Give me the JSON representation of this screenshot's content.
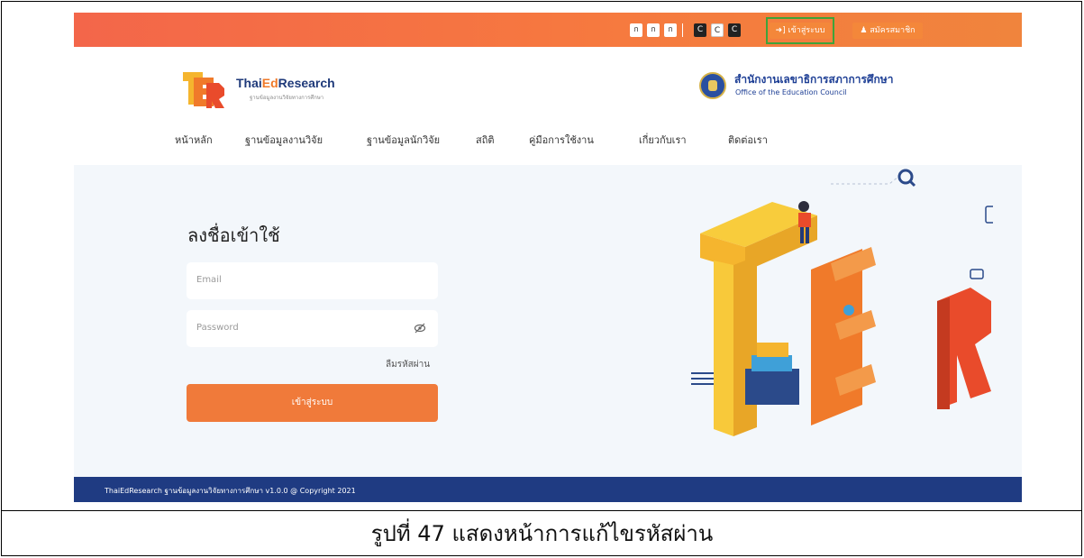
{
  "topbar": {
    "font_size_buttons": [
      "ก",
      "ก",
      "ก"
    ],
    "contrast_buttons": [
      "C",
      "C",
      "C"
    ],
    "login_label": "เข้าสู่ระบบ",
    "register_label": "สมัครสมาชิก"
  },
  "brand": {
    "name_prefix": "Thai",
    "name_highlight": "Ed",
    "name_suffix": "Research",
    "tagline": "ฐานข้อมูลงานวิจัยทางการศึกษา"
  },
  "agency": {
    "name_th": "สำนักงานเลขาธิการสภาการศึกษา",
    "name_en": "Office of the Education Council"
  },
  "nav": {
    "items": [
      "หน้าหลัก",
      "ฐานข้อมูลงานวิจัย",
      "ฐานข้อมูลนักวิจัย",
      "สถิติ",
      "คู่มือการใช้งาน",
      "เกี่ยวกับเรา",
      "ติดต่อเรา"
    ]
  },
  "login": {
    "title": "ลงชื่อเข้าใช้",
    "email_placeholder": "Email",
    "password_placeholder": "Password",
    "forgot_label": "ลืมรหัสผ่าน",
    "submit_label": "เข้าสู่ระบบ"
  },
  "footer": {
    "text": "ThaiEdResearch ฐานข้อมูลงานวิจัยทางการศึกษา v1.0.0 @ Copyright 2021"
  },
  "caption": "รูปที่ 47 แสดงหน้าการแก้ไขรหัสผ่าน",
  "colors": {
    "accent": "#f07a3a",
    "footer": "#1f3b82",
    "highlight_border": "#3fa33a"
  }
}
